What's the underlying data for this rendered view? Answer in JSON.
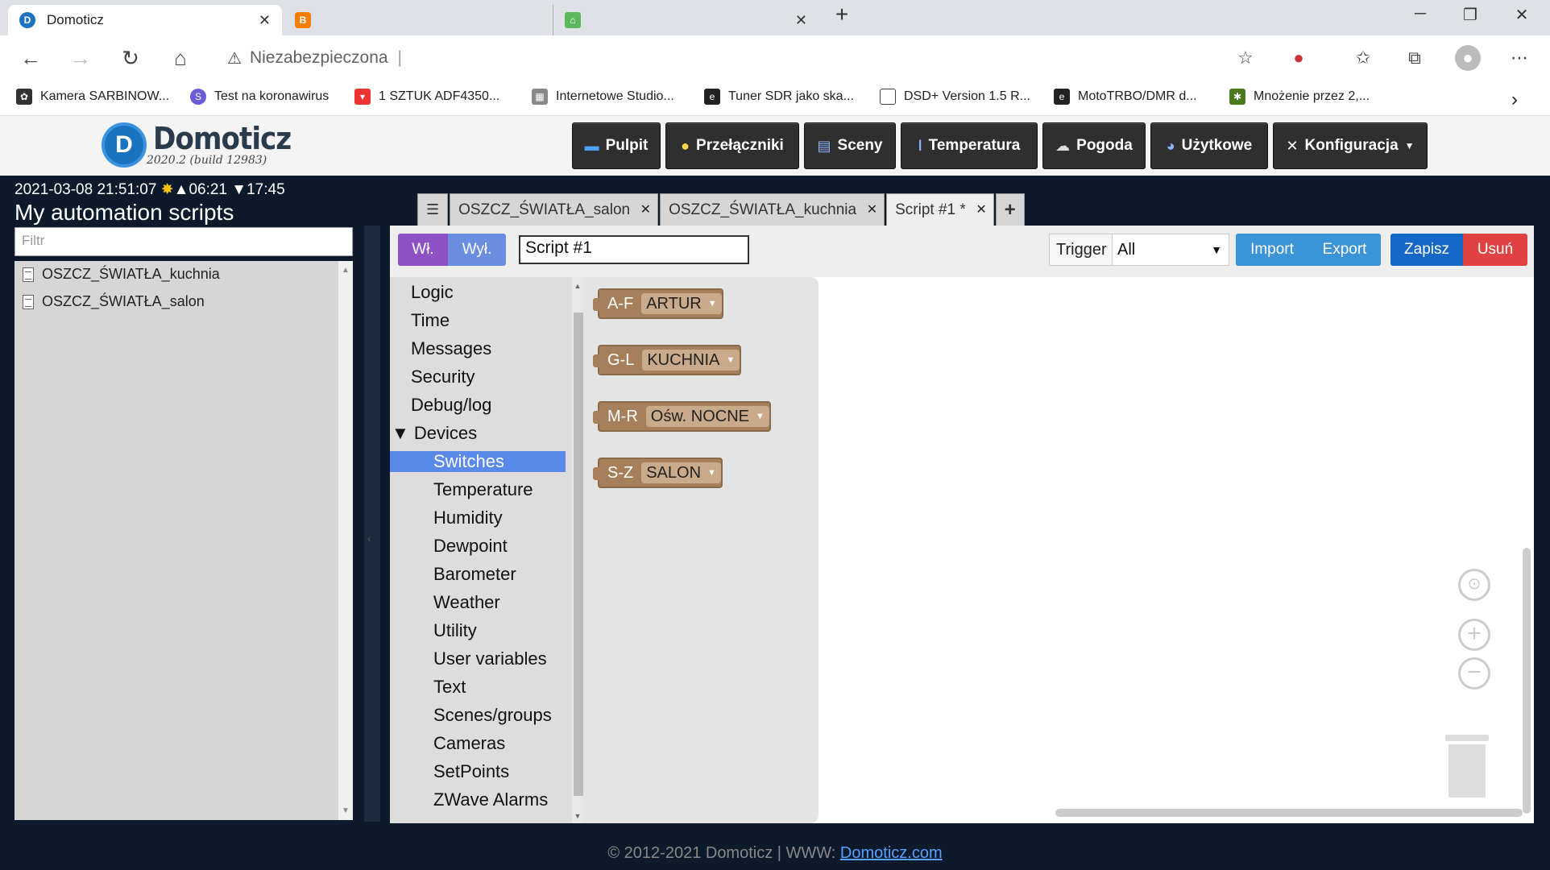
{
  "browser": {
    "tabs": [
      {
        "title": "Domoticz",
        "active": true
      },
      {
        "title": "",
        "active": false
      },
      {
        "title": "",
        "active": false
      }
    ],
    "address": "Niezabezpieczona",
    "bookmarks": [
      "Kamera SARBINOW...",
      "Test na koronawirus",
      "1 SZTUK ADF4350...",
      "Internetowe Studio...",
      "Tuner SDR jako ska...",
      "DSD+ Version 1.5 R...",
      "MotoTRBO/DMR d...",
      "Mnożenie przez 2,..."
    ]
  },
  "header": {
    "logo_name": "Domoticz",
    "logo_version": "2020.2 (build 12983)",
    "nav": [
      "Pulpit",
      "Przełączniki",
      "Sceny",
      "Temperatura",
      "Pogoda",
      "Użytkowe",
      "Konfiguracja"
    ]
  },
  "status": {
    "datetime": "2021-03-08 21:51:07",
    "sunrise": "06:21",
    "sunset": "17:45"
  },
  "left": {
    "title": "My automation scripts",
    "filter_placeholder": "Filtr",
    "scripts": [
      "OSZCZ_ŚWIATŁA_kuchnia",
      "OSZCZ_ŚWIATŁA_salon"
    ]
  },
  "editor_tabs": [
    {
      "label": "OSZCZ_ŚWIATŁA_salon",
      "active": false
    },
    {
      "label": "OSZCZ_ŚWIATŁA_kuchnia",
      "active": false
    },
    {
      "label": "Script #1 *",
      "active": true
    }
  ],
  "toolbar": {
    "on": "Wł.",
    "off": "Wył.",
    "script_name": "Script #1",
    "trigger_label": "Trigger",
    "trigger_value": "All",
    "import": "Import",
    "export": "Export",
    "save": "Zapisz",
    "delete": "Usuń"
  },
  "toolbox": {
    "categories": [
      "Logic",
      "Time",
      "Messages",
      "Security",
      "Debug/log"
    ],
    "devices_label": "Devices",
    "device_items": [
      "Switches",
      "Temperature",
      "Humidity",
      "Dewpoint",
      "Barometer",
      "Weather",
      "Utility",
      "User variables",
      "Text",
      "Scenes/groups",
      "Cameras",
      "SetPoints",
      "ZWave Alarms"
    ],
    "selected": "Switches"
  },
  "flyout_blocks": [
    {
      "range": "A-F",
      "value": "ARTUR"
    },
    {
      "range": "G-L",
      "value": "KUCHNIA"
    },
    {
      "range": "M-R",
      "value": "Ośw. NOCNE"
    },
    {
      "range": "S-Z",
      "value": "SALON"
    }
  ],
  "footer": {
    "text": "© 2012-2021 Domoticz | WWW: ",
    "link": "Domoticz.com"
  },
  "colors": {
    "dark_bg": "#0d1a2c",
    "block": "#a5805b",
    "selected_toolbox": "#5b89ea",
    "on_btn": "#8e52c4",
    "off_btn": "#6c8ee0",
    "import_export": "#3b93d8",
    "save": "#1668c8",
    "delete": "#e04141"
  }
}
